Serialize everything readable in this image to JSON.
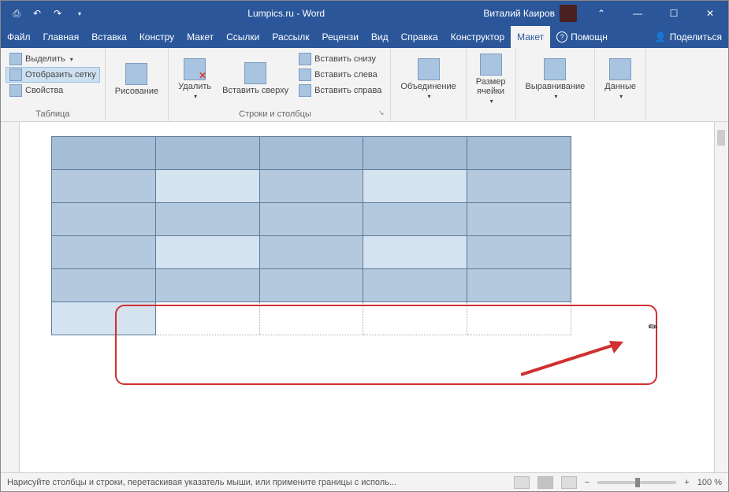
{
  "titlebar": {
    "title": "Lumpics.ru - Word",
    "user": "Виталий Каиров"
  },
  "menu": {
    "file": "Файл",
    "home": "Главная",
    "insert": "Вставка",
    "design": "Констру",
    "layoutPage": "Макет",
    "references": "Ссылки",
    "mailings": "Рассылк",
    "review": "Рецензи",
    "view": "Вид",
    "help": "Справка",
    "tableDesign": "Конструктор",
    "tableLayout": "Макет",
    "tell": "Помощн",
    "share": "Поделиться"
  },
  "ribbon": {
    "table": {
      "select": "Выделить",
      "viewGrid": "Отобразить сетку",
      "props": "Свойства",
      "label": "Таблица"
    },
    "draw": {
      "draw": "Рисование"
    },
    "rc": {
      "delete": "Удалить",
      "insertAbove": "Вставить сверху",
      "insertBelow": "Вставить снизу",
      "insertLeft": "Вставить слева",
      "insertRight": "Вставить справа",
      "label": "Строки и столбцы"
    },
    "merge": {
      "label": "Объединение"
    },
    "size": {
      "line1": "Размер",
      "line2": "ячейки"
    },
    "align": {
      "label": "Выравнивание"
    },
    "data": {
      "label": "Данные"
    }
  },
  "status": {
    "msg": "Нарисуйте столбцы и строки, перетаскивая указатель мыши, или примените границы с исполь...",
    "zoom": "100 %"
  }
}
